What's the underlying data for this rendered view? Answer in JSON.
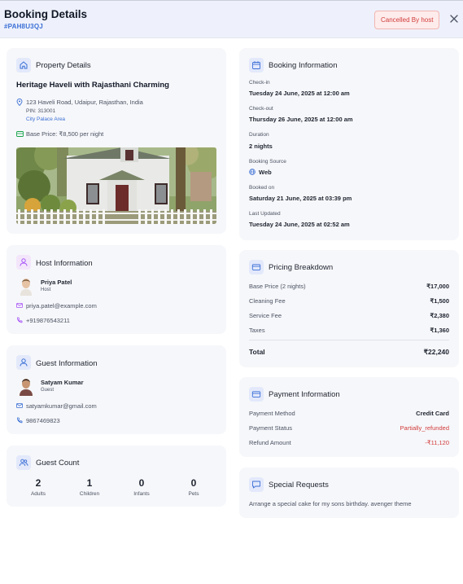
{
  "header": {
    "title": "Booking Details",
    "booking_id": "#PAH8U3QJ",
    "status": "Cancelled By host"
  },
  "property": {
    "section_title": "Property Details",
    "name": "Heritage Haveli with Rajasthani Charming",
    "address": "123 Haveli Road, Udaipur, Rajasthan, India",
    "pin": "PIN: 313001",
    "area": "City Palace Area",
    "base_price": "Base Price: ₹8,500 per night"
  },
  "host": {
    "section_title": "Host Information",
    "name": "Priya Patel",
    "role": "Host",
    "email": "priya.patel@example.com",
    "phone": "+919876543211"
  },
  "guest": {
    "section_title": "Guest Information",
    "name": "Satyam Kumar",
    "role": "Guest",
    "email": "satyamkumar@gmail.com",
    "phone": "9867469823"
  },
  "guest_count": {
    "section_title": "Guest Count",
    "items": [
      {
        "value": "2",
        "label": "Adults"
      },
      {
        "value": "1",
        "label": "Children"
      },
      {
        "value": "0",
        "label": "Infants"
      },
      {
        "value": "0",
        "label": "Pets"
      }
    ]
  },
  "booking": {
    "section_title": "Booking Information",
    "checkin_label": "Check-in",
    "checkin": "Tuesday 24 June, 2025 at 12:00 am",
    "checkout_label": "Check-out",
    "checkout": "Thursday 26 June, 2025 at 12:00 am",
    "duration_label": "Duration",
    "duration": "2 nights",
    "source_label": "Booking Source",
    "source": "Web",
    "booked_label": "Booked on",
    "booked": "Saturday 21 June, 2025 at 03:39 pm",
    "updated_label": "Last Updated",
    "updated": "Tuesday 24 June, 2025 at 02:52 am"
  },
  "pricing": {
    "section_title": "Pricing Breakdown",
    "rows": [
      {
        "label": "Base Price (2 nights)",
        "value": "₹17,000"
      },
      {
        "label": "Cleaning Fee",
        "value": "₹1,500"
      },
      {
        "label": "Service Fee",
        "value": "₹2,380"
      },
      {
        "label": "Taxes",
        "value": "₹1,360"
      }
    ],
    "total_label": "Total",
    "total": "₹22,240"
  },
  "payment": {
    "section_title": "Payment Information",
    "method_label": "Payment Method",
    "method": "Credit Card",
    "status_label": "Payment Status",
    "status": "Partially_refunded",
    "refund_label": "Refund Amount",
    "refund": "-₹11,120"
  },
  "requests": {
    "section_title": "Special Requests",
    "text": "Arrange a special cake for my sons birthday. avenger theme"
  },
  "colors": {
    "accent": "#3b6fd6",
    "danger": "#d23b3b",
    "card_bg": "#f6f7fa",
    "header_bg": "#eef1fb"
  }
}
